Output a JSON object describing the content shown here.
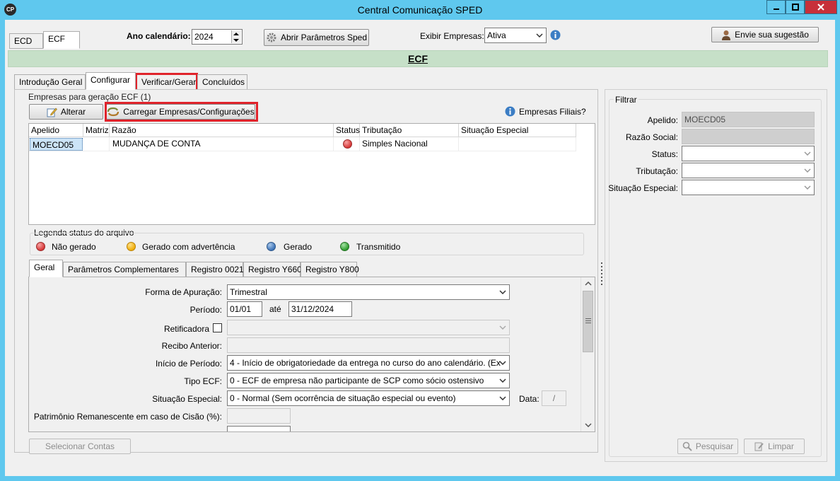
{
  "window": {
    "title": "Central Comunicação SPED",
    "app_icon_text": "CP"
  },
  "top_tabs": [
    {
      "label": "ECD",
      "active": false
    },
    {
      "label": "ECF",
      "active": true
    }
  ],
  "toolbar": {
    "ano_label": "Ano calendário:",
    "ano_value": "2024",
    "abrir_parametros_label": "Abrir Parâmetros Sped",
    "exibir_empresas_label": "Exibir Empresas:",
    "exibir_empresas_value": "Ativa",
    "sugestao_label": "Envie sua sugestão"
  },
  "section_title": "ECF",
  "step_tabs": [
    {
      "label": "Introdução Geral",
      "active": false
    },
    {
      "label": "Configurar",
      "active": true
    },
    {
      "label": "Verificar/Gerar",
      "active": false
    },
    {
      "label": "Concluídos",
      "active": false
    }
  ],
  "empresas": {
    "group_label": "Empresas para geração ECF (1)",
    "alterar_label": "Alterar",
    "carregar_label": "Carregar Empresas/Configurações",
    "filiais_label": "Empresas Filiais?",
    "columns": [
      "Apelido",
      "Matriz",
      "Razão",
      "Status",
      "Tributação",
      "Situação Especial"
    ],
    "rows": [
      {
        "apelido": "MOECD05",
        "matriz": "",
        "razao": "MUDANÇA DE CONTA",
        "status_color": "#e34a4a",
        "tributacao": "Simples Nacional",
        "situacao": ""
      }
    ]
  },
  "legenda": {
    "title": "Legenda status do arquivo",
    "items": [
      {
        "label": "Não gerado",
        "color": "#e34a4a"
      },
      {
        "label": "Gerado com advertência",
        "color": "#f5b80f"
      },
      {
        "label": "Gerado",
        "color": "#4f86c6"
      },
      {
        "label": "Transmitido",
        "color": "#3fae3f"
      }
    ]
  },
  "inner_tabs": [
    {
      "label": "Geral",
      "active": true
    },
    {
      "label": "Parâmetros Complementares",
      "active": false
    },
    {
      "label": "Registro 0021",
      "active": false
    },
    {
      "label": "Registro Y660",
      "active": false
    },
    {
      "label": "Registro Y800",
      "active": false
    }
  ],
  "form": {
    "forma_apuracao_label": "Forma de Apuração:",
    "forma_apuracao_value": "Trimestral",
    "periodo_label": "Período:",
    "periodo_inicio": "01/01",
    "periodo_ate_label": "até",
    "periodo_fim": "31/12/2024",
    "retificadora_label": "Retificadora",
    "retificadora_value": "",
    "recibo_label": "Recibo Anterior:",
    "recibo_value": "",
    "inicio_periodo_label": "Início de Período:",
    "inicio_periodo_value": "4 - Início de obrigatoriedade da entrega no curso do ano calendário. (Ex",
    "tipo_ecf_label": "Tipo ECF:",
    "tipo_ecf_value": "0 - ECF de empresa não participante de SCP como sócio ostensivo",
    "situacao_label": "Situação Especial:",
    "situacao_value": "0 - Normal (Sem ocorrência de situação especial ou evento)",
    "data_label": "Data:",
    "data_value": "/",
    "patrimonio_label": "Patrimônio Remanescente em caso de Cisão (%):",
    "patrimonio_value": ""
  },
  "selecionar_contas_label": "Selecionar Contas",
  "filtrar": {
    "title": "Filtrar",
    "apelido_label": "Apelido:",
    "apelido_value": "MOECD05",
    "razao_label": "Razão Social:",
    "razao_value": "",
    "status_label": "Status:",
    "tributacao_label": "Tributação:",
    "situacao_label": "Situação Especial:",
    "pesquisar_label": "Pesquisar",
    "limpar_label": "Limpar"
  }
}
